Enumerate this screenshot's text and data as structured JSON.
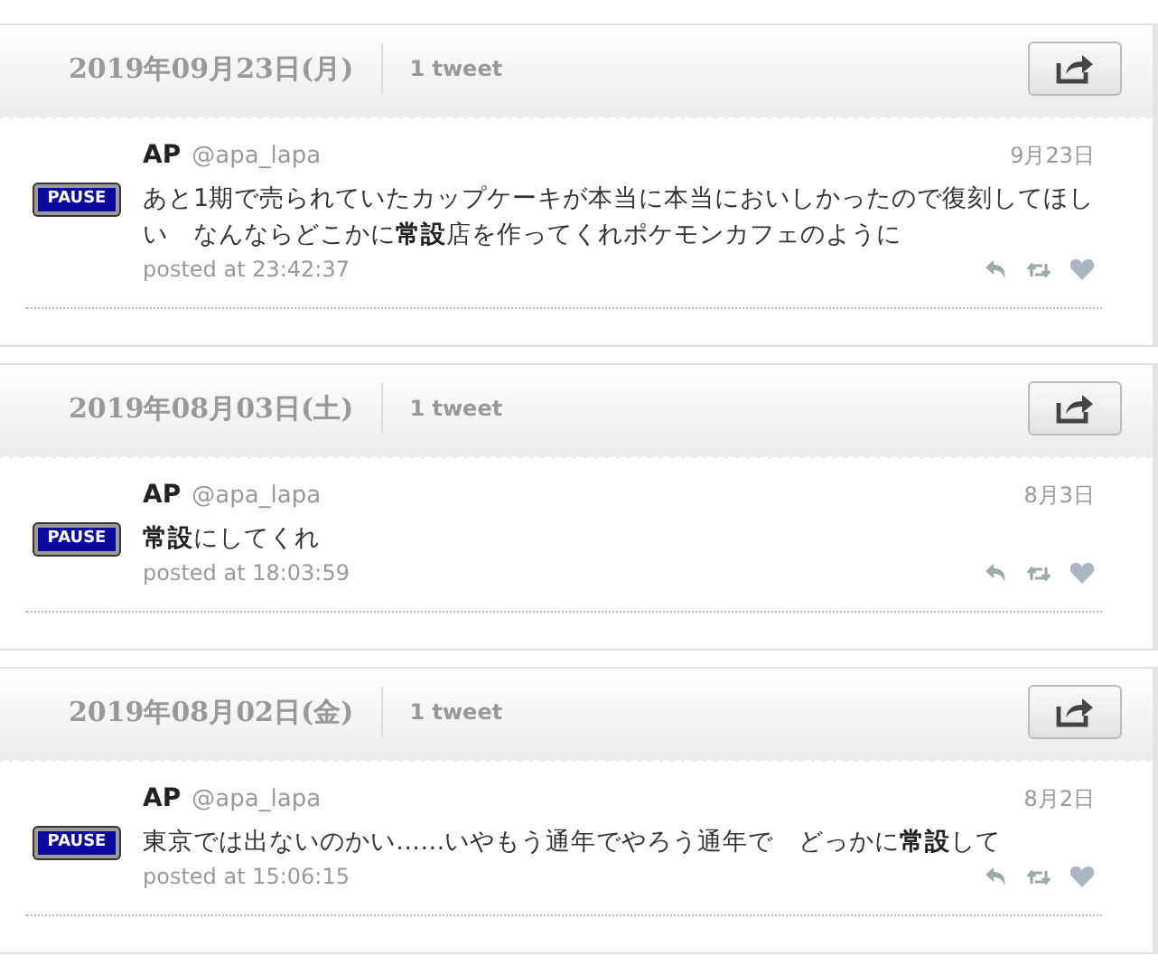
{
  "days": [
    {
      "date": "2019年09月23日(月)",
      "count": "1 tweet",
      "tweets": [
        {
          "avatar": "PAUSE",
          "name": "AP",
          "handle": "@apa_lapa",
          "date": "9月23日",
          "text": "あと1期で売られていたカップケーキが本当に本当においしかったので復刻してほしい　なんならどこかに**常設**店を作ってくれポケモンカフェのように",
          "posted": "posted at 23:42:37"
        }
      ]
    },
    {
      "date": "2019年08月03日(土)",
      "count": "1 tweet",
      "tweets": [
        {
          "avatar": "PAUSE",
          "name": "AP",
          "handle": "@apa_lapa",
          "date": "8月3日",
          "text": "**常設**にしてくれ",
          "posted": "posted at 18:03:59"
        }
      ]
    },
    {
      "date": "2019年08月02日(金)",
      "count": "1 tweet",
      "tweets": [
        {
          "avatar": "PAUSE",
          "name": "AP",
          "handle": "@apa_lapa",
          "date": "8月2日",
          "text": "東京では出ないのかい……いやもう通年でやろう通年で　どっかに**常設**して",
          "posted": "posted at 15:06:15"
        }
      ]
    }
  ]
}
